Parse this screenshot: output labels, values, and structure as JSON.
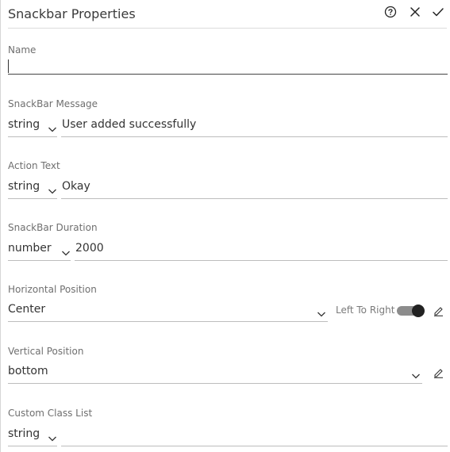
{
  "header": {
    "title": "Snackbar Properties",
    "help_icon": "help-circle-icon",
    "close_icon": "close-icon",
    "confirm_icon": "check-icon"
  },
  "fields": {
    "name": {
      "label": "Name",
      "value": ""
    },
    "snackbar_message": {
      "label": "SnackBar Message",
      "type": "string",
      "value": "User added successfully"
    },
    "action_text": {
      "label": "Action Text",
      "type": "string",
      "value": "Okay"
    },
    "snackbar_duration": {
      "label": "SnackBar Duration",
      "type": "number",
      "value": "2000"
    },
    "horizontal_position": {
      "label": "Horizontal Position",
      "value": "Center",
      "toggle_label": "Left To Right",
      "toggle_on": true
    },
    "vertical_position": {
      "label": "Vertical Position",
      "value": "bottom"
    },
    "custom_class_list": {
      "label": "Custom Class List",
      "type": "string",
      "value": ""
    }
  }
}
